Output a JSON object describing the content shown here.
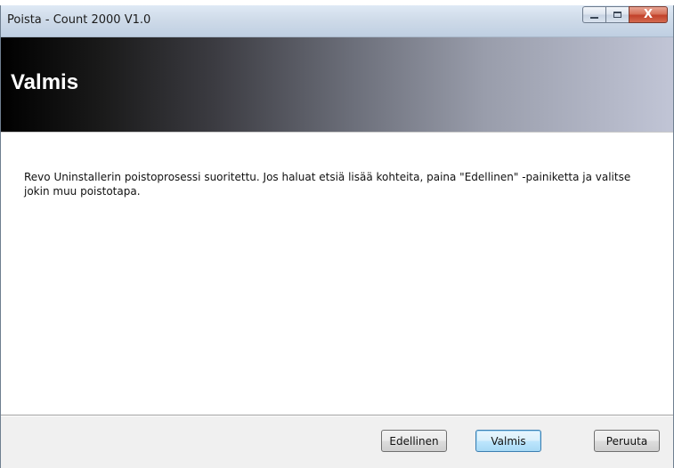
{
  "window": {
    "title": "Poista - Count 2000 V1.0",
    "buttons": {
      "minimize_icon": "minimize-icon",
      "maximize_icon": "maximize-icon",
      "close_icon": "close-icon",
      "close_glyph": "X"
    }
  },
  "banner": {
    "title": "Valmis"
  },
  "content": {
    "message": "Revo Uninstallerin poistoprosessi suoritettu. Jos haluat etsiä lisää kohteita, paina \"Edellinen\" -painiketta ja valitse jokin muu poistotapa."
  },
  "footer": {
    "back_label": "Edellinen",
    "finish_label": "Valmis",
    "cancel_label": "Peruuta"
  },
  "colors": {
    "close_button": "#c2412a",
    "default_button_border": "#3c7fb1"
  }
}
